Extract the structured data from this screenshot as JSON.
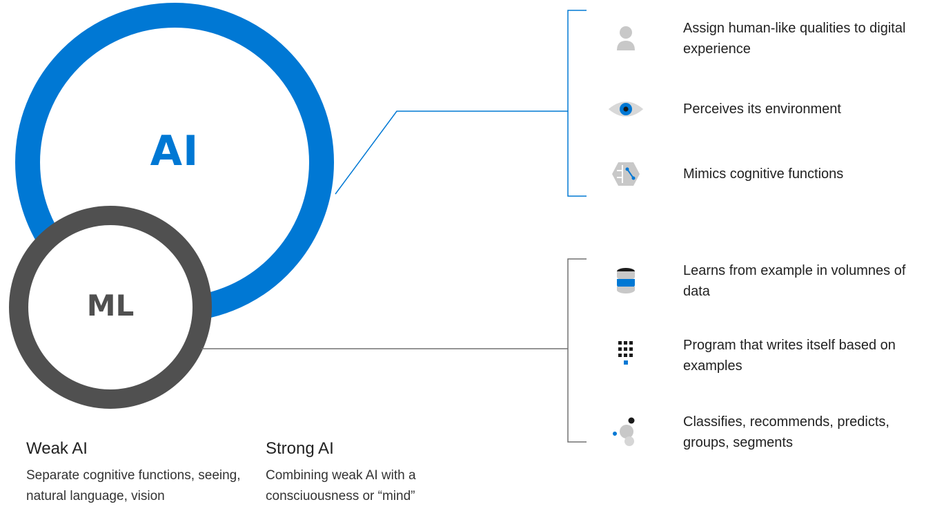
{
  "circles": {
    "ai": {
      "label": "AI",
      "color": "#0078d4"
    },
    "ml": {
      "label": "ML",
      "color": "#505050"
    }
  },
  "ai_items": [
    {
      "icon": "person-icon",
      "text": "Assign human-like qualities to digital experience"
    },
    {
      "icon": "eye-icon",
      "text": "Perceives its environment"
    },
    {
      "icon": "brain-circuit-icon",
      "text": "Mimics cognitive functions"
    }
  ],
  "ml_items": [
    {
      "icon": "database-icon",
      "text": "Learns from example in volumnes of data"
    },
    {
      "icon": "dot-grid-icon",
      "text": "Program that writes itself based on examples"
    },
    {
      "icon": "cluster-icon",
      "text": "Classifies, recommends, predicts, groups, segments"
    }
  ],
  "weak_ai": {
    "title": "Weak AI",
    "description": "Separate cognitive functions, seeing, natural language, vision"
  },
  "strong_ai": {
    "title": "Strong AI",
    "description": "Combining weak AI with a consciuousness or “mind”"
  },
  "colors": {
    "accent_blue": "#0078d4",
    "ml_gray": "#505050",
    "icon_gray": "#c8c8c8",
    "connector_gray": "#707070"
  }
}
